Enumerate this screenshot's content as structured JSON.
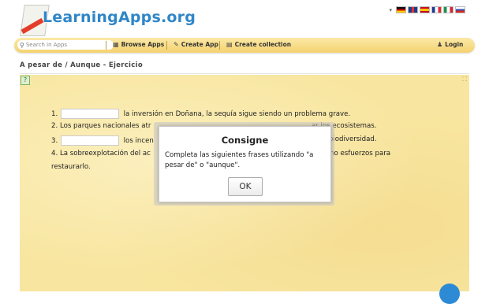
{
  "brand": {
    "logo_text": "LearningApps.org"
  },
  "languages": [
    "Deutsch",
    "English",
    "Español",
    "Français",
    "Italiano",
    "Русский"
  ],
  "nav": {
    "search_placeholder": "Search in Apps",
    "browse": "Browse Apps",
    "create": "Create App",
    "collection": "Create collection",
    "login": "Login"
  },
  "breadcrumb": "A pesar de / Aunque - Ejercicio",
  "exercise": {
    "lines": [
      {
        "num": "1.",
        "before": "",
        "after": "la inversión en Doñana, la sequía sigue siendo un problema grave."
      },
      {
        "num": "2.",
        "text_left": "Los parques nacionales atr",
        "text_right": "ar los ecosistemas."
      },
      {
        "num": "3.",
        "after_left": "los incen",
        "text_right": "er la biodiversidad."
      },
      {
        "num": "4.",
        "text_left": "La sobreexplotación del ac",
        "text_right": "echo esfuerzos para",
        "continuation": "restaurarlo."
      }
    ]
  },
  "modal": {
    "title": "Consigne",
    "text": "Completa las siguientes frases utilizando \"a pesar de\" o \"aunque\".",
    "ok": "OK"
  },
  "colors": {
    "accent": "#2f86c8",
    "navbar": "#f4d26f",
    "canvas": "#f8e6a0"
  }
}
